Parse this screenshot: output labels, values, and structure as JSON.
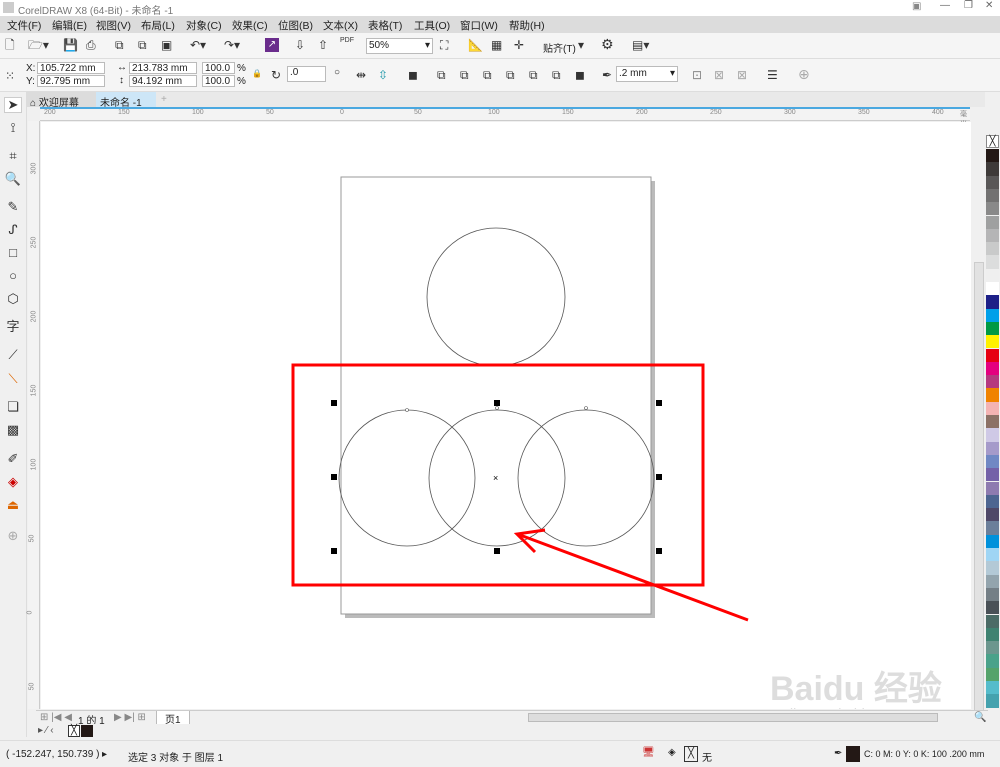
{
  "window": {
    "title": "CorelDRAW X8 (64-Bit) - 未命名 -1"
  },
  "menu": [
    "文件(F)",
    "编辑(E)",
    "视图(V)",
    "布局(L)",
    "对象(C)",
    "效果(C)",
    "位图(B)",
    "文本(X)",
    "表格(T)",
    "工具(O)",
    "窗口(W)",
    "帮助(H)"
  ],
  "standard_toolbar": {
    "zoom_level": "50%",
    "snap_label": "贴齐(T)",
    "pdf_label": "PDF"
  },
  "property_bar": {
    "x": "105.722 mm",
    "y": "92.795 mm",
    "x_label": "X:",
    "y_label": "Y:",
    "width": "213.783 mm",
    "height": "94.192 mm",
    "scale_x": "100.0",
    "scale_y": "100.0",
    "percent": "%",
    "rotation": ".0",
    "outline_width": ".2 mm"
  },
  "tabs": [
    {
      "label": "欢迎屏幕"
    },
    {
      "label": "未命名 -1"
    }
  ],
  "ruler": {
    "h_ticks": [
      "200",
      "150",
      "100",
      "50",
      "0",
      "50",
      "100",
      "150",
      "200",
      "250",
      "300",
      "350",
      "400"
    ],
    "h_unit": "毫米",
    "v_ticks": [
      "300",
      "250",
      "200",
      "150",
      "100",
      "50",
      "0",
      "50"
    ]
  },
  "palette": [
    "#231815",
    "#3e3a39",
    "#595757",
    "#727171",
    "#898989",
    "#9fa0a0",
    "#b5b5b6",
    "#c9caca",
    "#dcdddd",
    "#efefef",
    "#ffffff",
    "#1d2088",
    "#00a0e9",
    "#009944",
    "#fff100",
    "#e60012",
    "#e4007f",
    "#b5397f",
    "#f08300",
    "#f4b3b3",
    "#8c7166",
    "#cfc9e6",
    "#a59aca",
    "#7088c4",
    "#7461a8",
    "#8e7bb0",
    "#4d6591",
    "#4f4868",
    "#6b7f9a",
    "#0091db",
    "#9fd5f4",
    "#b3c9d6",
    "#93a4ad",
    "#747f86",
    "#4a5157",
    "#4b6b66",
    "#3f8271",
    "#6c968e",
    "#4aa28a",
    "#55a36b",
    "#55bccb",
    "#45a2ae"
  ],
  "pagenav": {
    "page_of": "1 的 1",
    "page_tab": "页1"
  },
  "status": {
    "coords": "( -152.247, 150.739 )",
    "selection": "选定 3 对象 于 图层 1",
    "fill_label": "无",
    "outline_info": "C: 0 M: 0 Y: 0 K: 100  .200 mm"
  },
  "annotation": {
    "highlight_color": "#ff0000"
  },
  "watermark": {
    "text1": "Baidu 经验",
    "text2": "jingyan.baidu.com"
  }
}
